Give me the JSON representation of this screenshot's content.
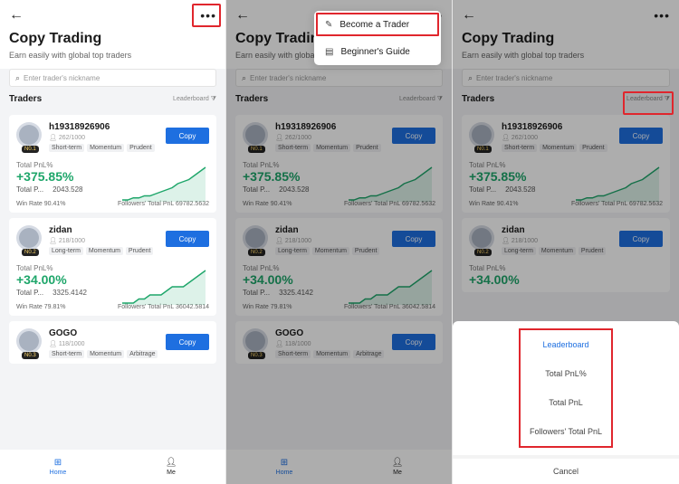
{
  "app": {
    "title": "Copy Trading",
    "subtitle": "Earn easily with global top traders",
    "search_placeholder": "Enter trader's nickname",
    "section_title": "Traders",
    "leaderboard_label": "Leaderboard",
    "copy_label": "Copy",
    "total_pnl_pct_label": "Total PnL%",
    "total_p_label": "Total P...",
    "win_rate_label": "Win Rate",
    "followers_total_pnl_label": "Followers' Total PnL",
    "more_icon": "more-icon",
    "back_icon": "back-arrow-icon"
  },
  "traders": [
    {
      "name": "h19318926906",
      "followers": "262/1000",
      "tags": [
        "Short-term",
        "Momentum",
        "Prudent"
      ],
      "badge": "N0.1",
      "pnl_pct": "+375.85%",
      "total_pnl": "2043.528",
      "win_rate": "90.41%",
      "followers_total_pnl": "69782.5632",
      "spark": [
        2,
        2,
        3,
        3,
        4,
        4,
        5,
        6,
        7,
        8,
        10,
        11,
        12,
        14,
        16,
        18
      ]
    },
    {
      "name": "zidan",
      "followers": "218/1000",
      "tags": [
        "Long-term",
        "Momentum",
        "Prudent"
      ],
      "badge": "N0.2",
      "pnl_pct": "+34.00%",
      "total_pnl": "3325.4142",
      "win_rate": "79.81%",
      "followers_total_pnl": "36042.5814",
      "spark": [
        1,
        1,
        1,
        2,
        2,
        3,
        3,
        3,
        4,
        5,
        5,
        5,
        6,
        7,
        8,
        9
      ]
    },
    {
      "name": "GOGO",
      "followers": "118/1000",
      "tags": [
        "Short-term",
        "Momentum",
        "Arbitrage"
      ],
      "badge": "N0.3"
    }
  ],
  "tabs": [
    {
      "label": "Home",
      "icon": "home-icon",
      "active": true
    },
    {
      "label": "Me",
      "icon": "user-icon",
      "active": false
    }
  ],
  "menu": {
    "items": [
      {
        "label": "Become a Trader",
        "icon": "edit-icon"
      },
      {
        "label": "Beginner's Guide",
        "icon": "guide-icon"
      }
    ]
  },
  "sheet": {
    "options": [
      "Leaderboard",
      "Total PnL%",
      "Total PnL",
      "Followers' Total PnL"
    ],
    "cancel": "Cancel"
  }
}
